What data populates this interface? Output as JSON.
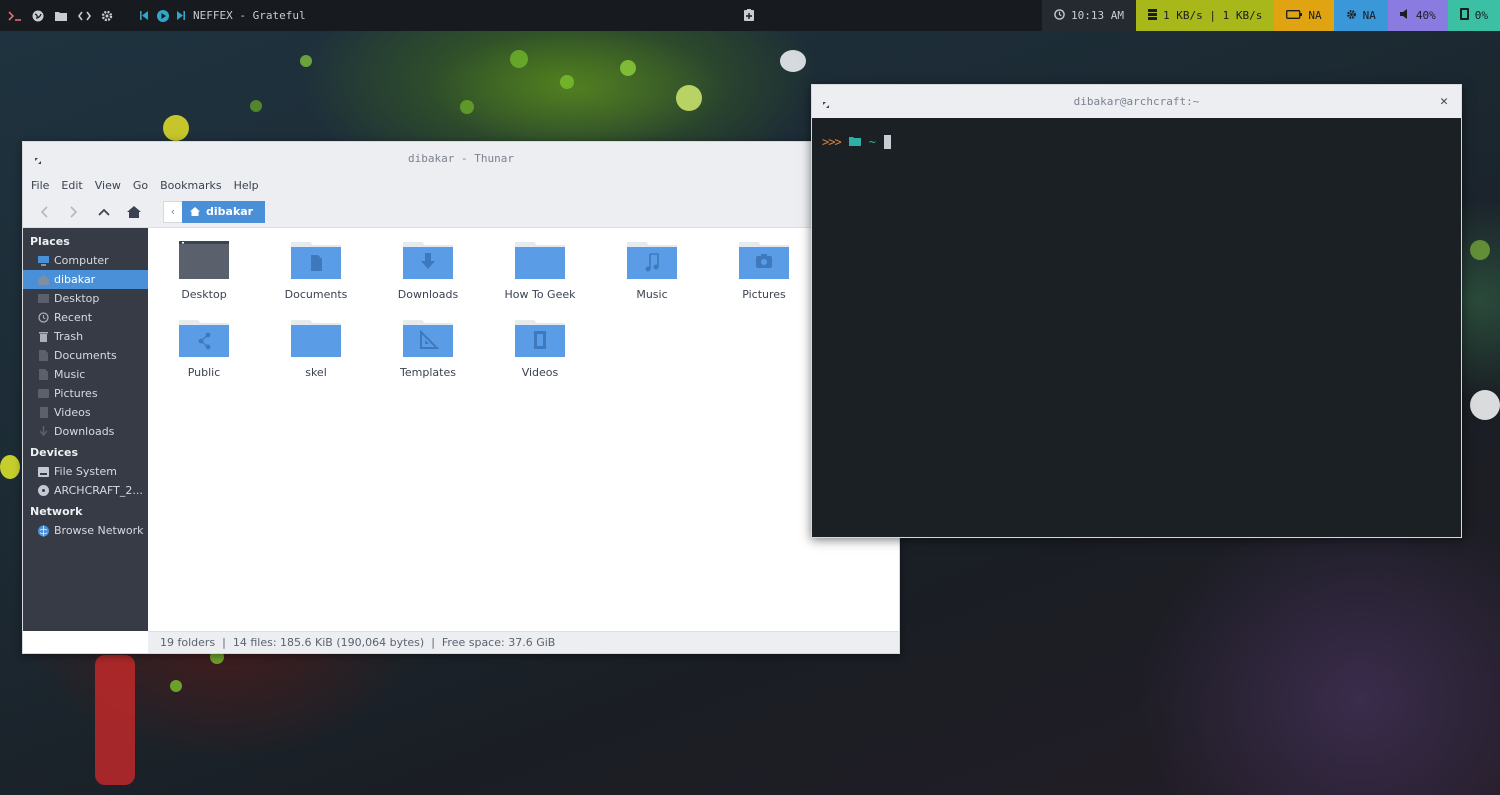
{
  "topbar": {
    "now_playing": "NEFFEX - Grateful",
    "clock": "10:13 AM",
    "network": "1 KB/s | 1 KB/s",
    "battery": "NA",
    "brightness": "NA",
    "volume": "40%",
    "memory": "0%",
    "colors": {
      "network": "#a8b81a",
      "battery": "#e0a412",
      "brightness": "#3a97d8",
      "volume": "#8a7be0",
      "memory": "#3bc0a3"
    }
  },
  "thunar": {
    "title": "dibakar - Thunar",
    "menu": [
      "File",
      "Edit",
      "View",
      "Go",
      "Bookmarks",
      "Help"
    ],
    "breadcrumb": "dibakar",
    "sidebar": {
      "places_heading": "Places",
      "places": [
        "Computer",
        "dibakar",
        "Desktop",
        "Recent",
        "Trash",
        "Documents",
        "Music",
        "Pictures",
        "Videos",
        "Downloads"
      ],
      "devices_heading": "Devices",
      "devices": [
        "File System",
        "ARCHCRAFT_2..."
      ],
      "network_heading": "Network",
      "network": [
        "Browse Network"
      ]
    },
    "items": [
      {
        "name": "Desktop",
        "icon": "desktop-icon"
      },
      {
        "name": "Documents",
        "icon": "document-folder-icon"
      },
      {
        "name": "Downloads",
        "icon": "download-folder-icon"
      },
      {
        "name": "How To Geek",
        "icon": "folder-icon"
      },
      {
        "name": "Music",
        "icon": "music-folder-icon"
      },
      {
        "name": "Pictures",
        "icon": "pictures-folder-icon"
      },
      {
        "name": "Public",
        "icon": "share-folder-icon"
      },
      {
        "name": "skel",
        "icon": "folder-icon"
      },
      {
        "name": "Templates",
        "icon": "templates-folder-icon"
      },
      {
        "name": "Videos",
        "icon": "videos-folder-icon"
      }
    ],
    "status": "19 folders  |  14 files: 185.6 KiB (190,064 bytes)  |  Free space: 37.6 GiB"
  },
  "terminal": {
    "title": "dibakar@archcraft:~",
    "prompt_arrows": ">>>",
    "prompt_dir": "~"
  }
}
